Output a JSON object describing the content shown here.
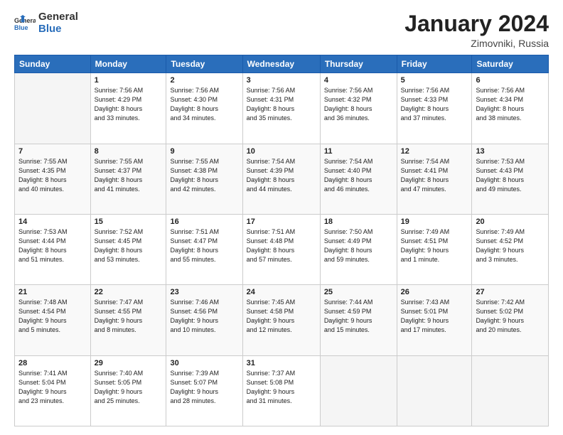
{
  "header": {
    "logo_general": "General",
    "logo_blue": "Blue",
    "title": "January 2024",
    "subtitle": "Zimovniki, Russia"
  },
  "weekdays": [
    "Sunday",
    "Monday",
    "Tuesday",
    "Wednesday",
    "Thursday",
    "Friday",
    "Saturday"
  ],
  "weeks": [
    [
      {
        "num": "",
        "empty": true
      },
      {
        "num": "1",
        "sunrise": "7:56 AM",
        "sunset": "4:29 PM",
        "daylight": "8 hours and 33 minutes."
      },
      {
        "num": "2",
        "sunrise": "7:56 AM",
        "sunset": "4:30 PM",
        "daylight": "8 hours and 34 minutes."
      },
      {
        "num": "3",
        "sunrise": "7:56 AM",
        "sunset": "4:31 PM",
        "daylight": "8 hours and 35 minutes."
      },
      {
        "num": "4",
        "sunrise": "7:56 AM",
        "sunset": "4:32 PM",
        "daylight": "8 hours and 36 minutes."
      },
      {
        "num": "5",
        "sunrise": "7:56 AM",
        "sunset": "4:33 PM",
        "daylight": "8 hours and 37 minutes."
      },
      {
        "num": "6",
        "sunrise": "7:56 AM",
        "sunset": "4:34 PM",
        "daylight": "8 hours and 38 minutes."
      }
    ],
    [
      {
        "num": "7",
        "sunrise": "7:55 AM",
        "sunset": "4:35 PM",
        "daylight": "8 hours and 40 minutes."
      },
      {
        "num": "8",
        "sunrise": "7:55 AM",
        "sunset": "4:37 PM",
        "daylight": "8 hours and 41 minutes."
      },
      {
        "num": "9",
        "sunrise": "7:55 AM",
        "sunset": "4:38 PM",
        "daylight": "8 hours and 42 minutes."
      },
      {
        "num": "10",
        "sunrise": "7:54 AM",
        "sunset": "4:39 PM",
        "daylight": "8 hours and 44 minutes."
      },
      {
        "num": "11",
        "sunrise": "7:54 AM",
        "sunset": "4:40 PM",
        "daylight": "8 hours and 46 minutes."
      },
      {
        "num": "12",
        "sunrise": "7:54 AM",
        "sunset": "4:41 PM",
        "daylight": "8 hours and 47 minutes."
      },
      {
        "num": "13",
        "sunrise": "7:53 AM",
        "sunset": "4:43 PM",
        "daylight": "8 hours and 49 minutes."
      }
    ],
    [
      {
        "num": "14",
        "sunrise": "7:53 AM",
        "sunset": "4:44 PM",
        "daylight": "8 hours and 51 minutes."
      },
      {
        "num": "15",
        "sunrise": "7:52 AM",
        "sunset": "4:45 PM",
        "daylight": "8 hours and 53 minutes."
      },
      {
        "num": "16",
        "sunrise": "7:51 AM",
        "sunset": "4:47 PM",
        "daylight": "8 hours and 55 minutes."
      },
      {
        "num": "17",
        "sunrise": "7:51 AM",
        "sunset": "4:48 PM",
        "daylight": "8 hours and 57 minutes."
      },
      {
        "num": "18",
        "sunrise": "7:50 AM",
        "sunset": "4:49 PM",
        "daylight": "8 hours and 59 minutes."
      },
      {
        "num": "19",
        "sunrise": "7:49 AM",
        "sunset": "4:51 PM",
        "daylight": "9 hours and 1 minute."
      },
      {
        "num": "20",
        "sunrise": "7:49 AM",
        "sunset": "4:52 PM",
        "daylight": "9 hours and 3 minutes."
      }
    ],
    [
      {
        "num": "21",
        "sunrise": "7:48 AM",
        "sunset": "4:54 PM",
        "daylight": "9 hours and 5 minutes."
      },
      {
        "num": "22",
        "sunrise": "7:47 AM",
        "sunset": "4:55 PM",
        "daylight": "9 hours and 8 minutes."
      },
      {
        "num": "23",
        "sunrise": "7:46 AM",
        "sunset": "4:56 PM",
        "daylight": "9 hours and 10 minutes."
      },
      {
        "num": "24",
        "sunrise": "7:45 AM",
        "sunset": "4:58 PM",
        "daylight": "9 hours and 12 minutes."
      },
      {
        "num": "25",
        "sunrise": "7:44 AM",
        "sunset": "4:59 PM",
        "daylight": "9 hours and 15 minutes."
      },
      {
        "num": "26",
        "sunrise": "7:43 AM",
        "sunset": "5:01 PM",
        "daylight": "9 hours and 17 minutes."
      },
      {
        "num": "27",
        "sunrise": "7:42 AM",
        "sunset": "5:02 PM",
        "daylight": "9 hours and 20 minutes."
      }
    ],
    [
      {
        "num": "28",
        "sunrise": "7:41 AM",
        "sunset": "5:04 PM",
        "daylight": "9 hours and 23 minutes."
      },
      {
        "num": "29",
        "sunrise": "7:40 AM",
        "sunset": "5:05 PM",
        "daylight": "9 hours and 25 minutes."
      },
      {
        "num": "30",
        "sunrise": "7:39 AM",
        "sunset": "5:07 PM",
        "daylight": "9 hours and 28 minutes."
      },
      {
        "num": "31",
        "sunrise": "7:37 AM",
        "sunset": "5:08 PM",
        "daylight": "9 hours and 31 minutes."
      },
      {
        "num": "",
        "empty": true
      },
      {
        "num": "",
        "empty": true
      },
      {
        "num": "",
        "empty": true
      }
    ]
  ],
  "labels": {
    "sunrise": "Sunrise:",
    "sunset": "Sunset:",
    "daylight": "Daylight:"
  }
}
